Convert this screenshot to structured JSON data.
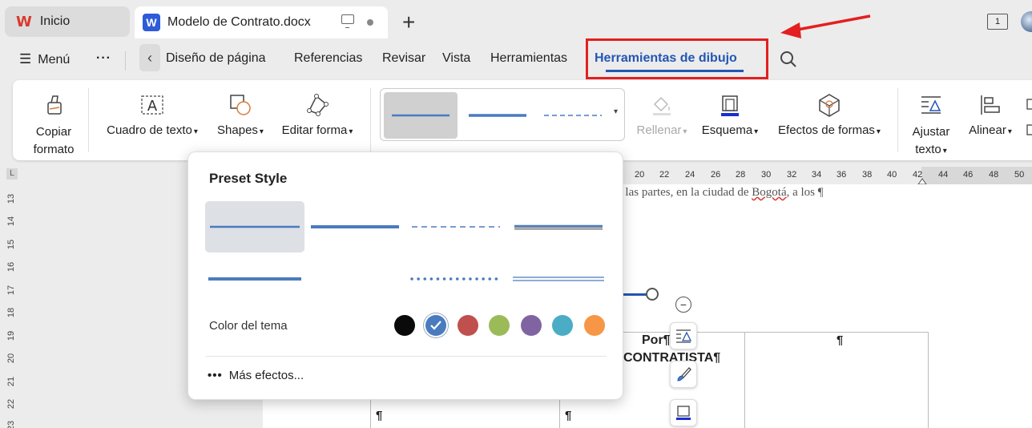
{
  "tabs": {
    "home_label": "Inicio",
    "doc_label": "Modelo de Contrato.docx",
    "add_label": "+",
    "page_indicator": "1"
  },
  "menu": {
    "menu_label": "Menú",
    "more_label": "···",
    "items": [
      "Diseño de página",
      "Referencias",
      "Revisar",
      "Vista",
      "Herramientas"
    ],
    "active_tab": "Herramientas de dibujo"
  },
  "ribbon": {
    "copy_format": [
      "Copiar",
      "formato"
    ],
    "text_box": "Cuadro de texto",
    "shapes": "Shapes",
    "edit_shape": "Editar forma",
    "fill": "Rellenar",
    "outline": "Esquema",
    "shape_effects": "Efectos de formas",
    "wrap_text": [
      "Ajustar",
      "texto"
    ],
    "align": "Alinear"
  },
  "ruler": {
    "h_ticks": [
      "20",
      "22",
      "24",
      "26",
      "28",
      "30",
      "32",
      "34",
      "36",
      "38",
      "40",
      "42",
      "44",
      "46",
      "48",
      "50"
    ],
    "v_ticks": [
      "13",
      "14",
      "15",
      "16",
      "17",
      "18",
      "19",
      "20",
      "21",
      "22",
      "23"
    ]
  },
  "document": {
    "line1_a": "e las partes, en la ciudad de ",
    "line1_b": "Bogotá",
    "line1_c": ", a los ¶",
    "cell_por": "Por¶",
    "cell_contratista": "CONTRATISTA¶",
    "pilcrow": "¶"
  },
  "popup": {
    "title": "Preset Style",
    "theme_color_label": "Color del tema",
    "more_effects_label": "Más efectos...",
    "more_icon": "•••",
    "colors": [
      "#0a0a0a",
      "#4a7bbf",
      "#c0504d",
      "#9bbb59",
      "#8064a2",
      "#4bacc6",
      "#f79646"
    ],
    "selected_color_index": 1
  },
  "accent": "#2456b3",
  "highlight": "#e3201f"
}
